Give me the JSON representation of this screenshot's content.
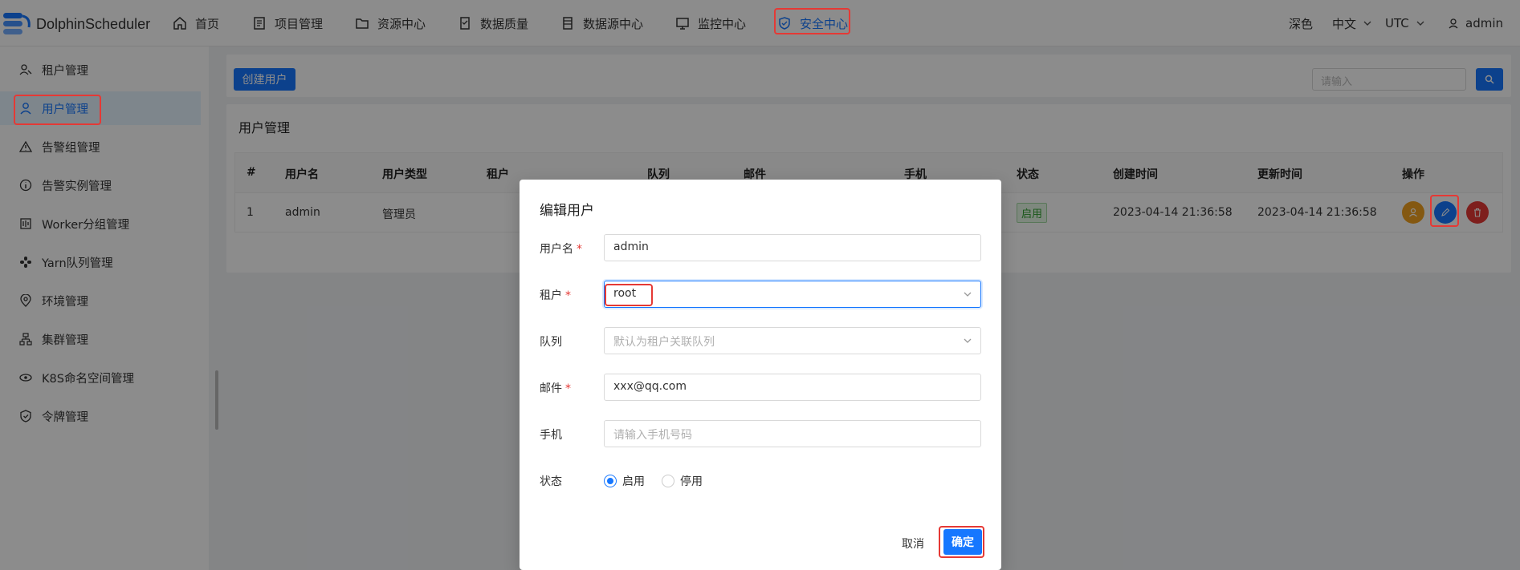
{
  "app": {
    "name": "DolphinScheduler"
  },
  "nav": [
    {
      "label": "首页",
      "icon": "home-icon"
    },
    {
      "label": "项目管理",
      "icon": "project-icon"
    },
    {
      "label": "资源中心",
      "icon": "folder-icon"
    },
    {
      "label": "数据质量",
      "icon": "data-quality-icon"
    },
    {
      "label": "数据源中心",
      "icon": "datasource-icon"
    },
    {
      "label": "监控中心",
      "icon": "monitor-icon"
    },
    {
      "label": "安全中心",
      "icon": "shield-icon",
      "active": true
    }
  ],
  "header_right": {
    "theme": "深色",
    "language": "中文",
    "timezone": "UTC",
    "user": "admin"
  },
  "sidebar": {
    "items": [
      {
        "label": "租户管理",
        "icon": "tenant-icon"
      },
      {
        "label": "用户管理",
        "icon": "user-icon",
        "active": true
      },
      {
        "label": "告警组管理",
        "icon": "warning-icon"
      },
      {
        "label": "告警实例管理",
        "icon": "info-icon"
      },
      {
        "label": "Worker分组管理",
        "icon": "worker-group-icon"
      },
      {
        "label": "Yarn队列管理",
        "icon": "yarn-queue-icon"
      },
      {
        "label": "环境管理",
        "icon": "location-icon"
      },
      {
        "label": "集群管理",
        "icon": "cluster-icon"
      },
      {
        "label": "K8S命名空间管理",
        "icon": "k8s-namespace-icon"
      },
      {
        "label": "令牌管理",
        "icon": "token-icon"
      }
    ]
  },
  "toolbar": {
    "create_user_label": "创建用户",
    "search_placeholder": "请输入"
  },
  "page": {
    "title": "用户管理"
  },
  "table": {
    "columns": [
      "#",
      "用户名",
      "用户类型",
      "租户",
      "队列",
      "邮件",
      "手机",
      "状态",
      "创建时间",
      "更新时间",
      "操作"
    ],
    "rows": [
      {
        "index": "1",
        "username": "admin",
        "user_type": "管理员",
        "tenant": "",
        "queue": "",
        "email": "",
        "phone": "",
        "status": "启用",
        "created": "2023-04-14 21:36:58",
        "updated": "2023-04-14 21:36:58"
      }
    ]
  },
  "modal": {
    "title": "编辑用户",
    "fields": {
      "username": {
        "label": "用户名",
        "value": "admin",
        "required": "*"
      },
      "tenant": {
        "label": "租户",
        "value": "root",
        "required": "*"
      },
      "queue": {
        "label": "队列",
        "placeholder": "默认为租户关联队列"
      },
      "email": {
        "label": "邮件",
        "value": "xxx@qq.com",
        "required": "*"
      },
      "phone": {
        "label": "手机",
        "placeholder": "请输入手机号码"
      },
      "status": {
        "label": "状态",
        "options": [
          "启用",
          "停用"
        ],
        "selected": "启用"
      }
    },
    "cancel_label": "取消",
    "confirm_label": "确定"
  },
  "colors": {
    "accent": "#1677ff",
    "highlight": "#e53935",
    "mask": "rgba(0,0,0,0.45)"
  }
}
